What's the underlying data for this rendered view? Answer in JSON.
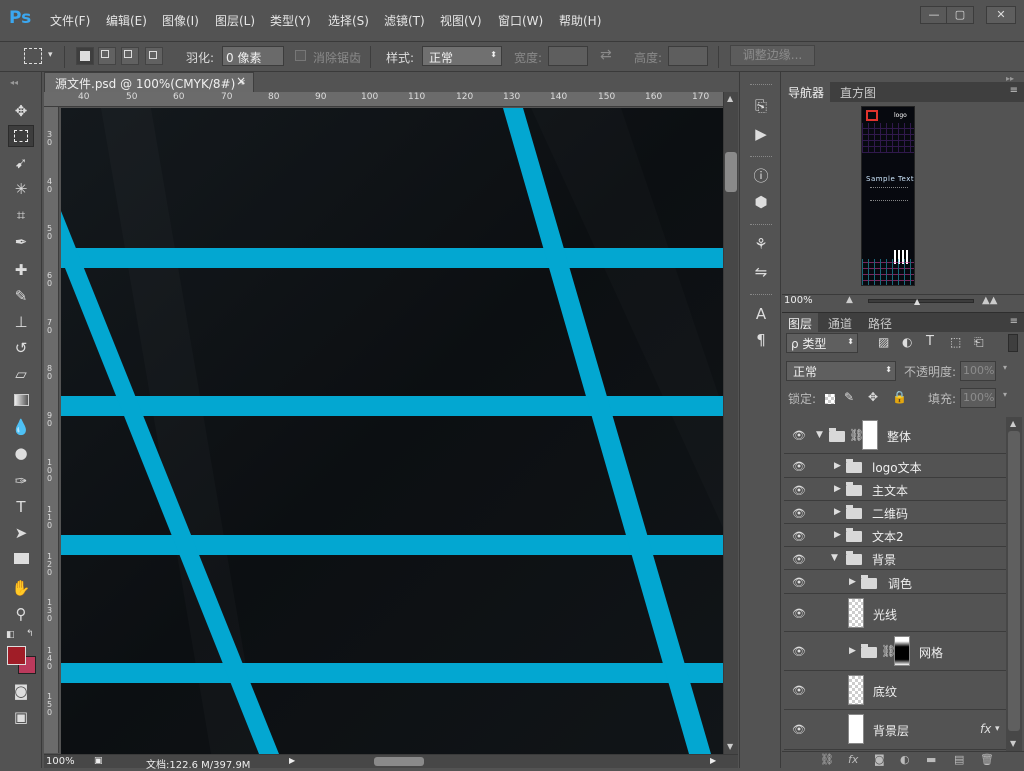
{
  "app": {
    "logo": "Ps",
    "menu": [
      "文件(F)",
      "编辑(E)",
      "图像(I)",
      "图层(L)",
      "类型(Y)",
      "选择(S)",
      "滤镜(T)",
      "视图(V)",
      "窗口(W)",
      "帮助(H)"
    ],
    "window_buttons": [
      "—",
      "▢",
      "✕"
    ]
  },
  "options": {
    "feather_label": "羽化:",
    "feather_value": "0 像素",
    "antialias_label": "消除锯齿",
    "style_label": "样式:",
    "style_value": "正常",
    "width_label": "宽度:",
    "height_label": "高度:",
    "refine_label": "调整边缘..."
  },
  "document": {
    "tab_title": "源文件.psd @ 100%(CMYK/8#) *",
    "close": "×",
    "ruler_top": [
      "40",
      "50",
      "60",
      "70",
      "80",
      "90",
      "100",
      "110",
      "120",
      "130",
      "140",
      "150",
      "160",
      "170"
    ],
    "ruler_left": [
      "3 0",
      "4 0",
      "5 0",
      "6 0",
      "7 0",
      "8 0",
      "9 0",
      "1 0 0",
      "1 1 0",
      "1 2 0",
      "1 3 0",
      "1 4 0",
      "1 5 0"
    ],
    "status_zoom": "100%",
    "status_doc": "文档:122.6 M/397.9M",
    "grid_color": "#03a7d1",
    "bg_color": "#0b0e11"
  },
  "navigator": {
    "tabs": [
      "导航器",
      "直方图"
    ],
    "zoom": "100%",
    "thumb_title": "Sample Text",
    "thumb_logo": "logo"
  },
  "layers_panel": {
    "tabs": [
      "图层",
      "通道",
      "路径"
    ],
    "filter_label": "ρ 类型",
    "blend_mode": "正常",
    "opacity_label": "不透明度:",
    "opacity_value": "100%",
    "lock_label": "锁定:",
    "fill_label": "填充:",
    "fill_value": "100%",
    "layers": [
      {
        "name": "整体",
        "type": "group-mask",
        "expanded": true
      },
      {
        "name": "logo文本",
        "type": "group"
      },
      {
        "name": "主文本",
        "type": "group"
      },
      {
        "name": "二维码",
        "type": "group"
      },
      {
        "name": "文本2",
        "type": "group"
      },
      {
        "name": "背景",
        "type": "group",
        "expanded": true
      },
      {
        "name": "调色",
        "type": "group"
      },
      {
        "name": "光线",
        "type": "layer"
      },
      {
        "name": "网格",
        "type": "group-mask"
      },
      {
        "name": "底纹",
        "type": "layer"
      },
      {
        "name": "背景层",
        "type": "layer",
        "fx": "fx"
      }
    ]
  }
}
